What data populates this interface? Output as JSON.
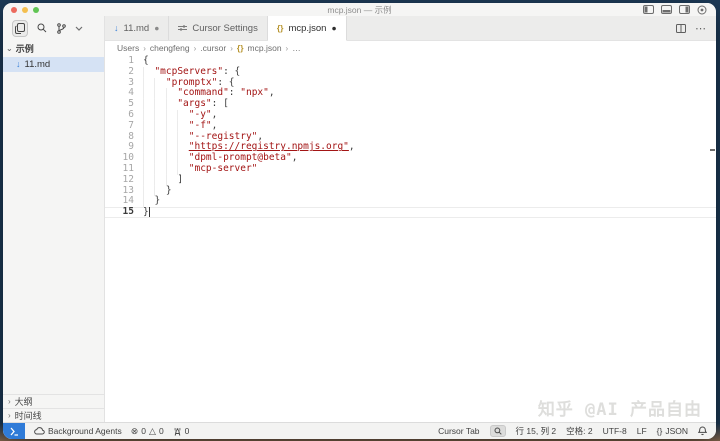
{
  "window": {
    "title": "mcp.json — 示例"
  },
  "titlebar_icons": [
    "toggle-left-sidebar",
    "toggle-bottom-panel",
    "toggle-right-sidebar",
    "customize-layout"
  ],
  "sidebar": {
    "section_label": "示例",
    "files": [
      {
        "name": "11.md",
        "icon": "markdown"
      }
    ],
    "bottom_items": [
      {
        "label": "大纲"
      },
      {
        "label": "时间线"
      }
    ]
  },
  "tabs": [
    {
      "label": "11.md",
      "icon": "markdown",
      "modified": true,
      "active": false
    },
    {
      "label": "Cursor Settings",
      "icon": "sliders",
      "modified": false,
      "active": false
    },
    {
      "label": "mcp.json",
      "icon": "braces",
      "modified": true,
      "active": true
    }
  ],
  "tab_actions": {
    "split_editor": "split-editor",
    "more": "⋯"
  },
  "breadcrumb": {
    "items": [
      "Users",
      "chengfeng",
      ".cursor",
      "mcp.json",
      "…"
    ],
    "separator": "›"
  },
  "editor": {
    "language": "json",
    "cursor_line": 15,
    "lines": [
      {
        "n": 1,
        "tokens": [
          [
            "p",
            "{"
          ]
        ]
      },
      {
        "n": 2,
        "tokens": [
          [
            "w",
            "  "
          ],
          [
            "s",
            "\"mcpServers\""
          ],
          [
            "p",
            ": {"
          ]
        ]
      },
      {
        "n": 3,
        "tokens": [
          [
            "w",
            "    "
          ],
          [
            "s",
            "\"promptx\""
          ],
          [
            "p",
            ": {"
          ]
        ]
      },
      {
        "n": 4,
        "tokens": [
          [
            "w",
            "      "
          ],
          [
            "s",
            "\"command\""
          ],
          [
            "p",
            ": "
          ],
          [
            "s",
            "\"npx\""
          ],
          [
            "p",
            ","
          ]
        ]
      },
      {
        "n": 5,
        "tokens": [
          [
            "w",
            "      "
          ],
          [
            "s",
            "\"args\""
          ],
          [
            "p",
            ": ["
          ]
        ]
      },
      {
        "n": 6,
        "tokens": [
          [
            "w",
            "        "
          ],
          [
            "s",
            "\"-y\""
          ],
          [
            "p",
            ","
          ]
        ]
      },
      {
        "n": 7,
        "tokens": [
          [
            "w",
            "        "
          ],
          [
            "s",
            "\"-f\""
          ],
          [
            "p",
            ","
          ]
        ]
      },
      {
        "n": 8,
        "tokens": [
          [
            "w",
            "        "
          ],
          [
            "s",
            "\"--registry\""
          ],
          [
            "p",
            ","
          ]
        ]
      },
      {
        "n": 9,
        "tokens": [
          [
            "w",
            "        "
          ],
          [
            "l",
            "\"https://registry.npmjs.org\""
          ],
          [
            "p",
            ","
          ]
        ]
      },
      {
        "n": 10,
        "tokens": [
          [
            "w",
            "        "
          ],
          [
            "s",
            "\"dpml-prompt@beta\""
          ],
          [
            "p",
            ","
          ]
        ]
      },
      {
        "n": 11,
        "tokens": [
          [
            "w",
            "        "
          ],
          [
            "s",
            "\"mcp-server\""
          ]
        ]
      },
      {
        "n": 12,
        "tokens": [
          [
            "w",
            "      "
          ],
          [
            "p",
            "]"
          ]
        ]
      },
      {
        "n": 13,
        "tokens": [
          [
            "w",
            "    "
          ],
          [
            "p",
            "}"
          ]
        ]
      },
      {
        "n": 14,
        "tokens": [
          [
            "w",
            "  "
          ],
          [
            "p",
            "}"
          ]
        ]
      },
      {
        "n": 15,
        "tokens": [
          [
            "p",
            "}"
          ]
        ]
      }
    ]
  },
  "watermark": "知乎 @AI 产品自由",
  "status_bar": {
    "background_agents": "Background Agents",
    "errors": "0",
    "warnings": "0",
    "ports": "0",
    "cursor_tab": "Cursor Tab",
    "line_col": "行 15, 列 2",
    "spaces": "空格: 2",
    "encoding": "UTF-8",
    "eol": "LF",
    "language_braces": "{}",
    "language": "JSON"
  },
  "colors": {
    "string": "#a31515",
    "punctuation": "#3b3b3b",
    "remote_badge": "#2f7bd8",
    "selected_file_bg": "#d5e2f4",
    "desktop_top": "#1e3c5a",
    "desktop_bottom": "#8a6a4f"
  }
}
